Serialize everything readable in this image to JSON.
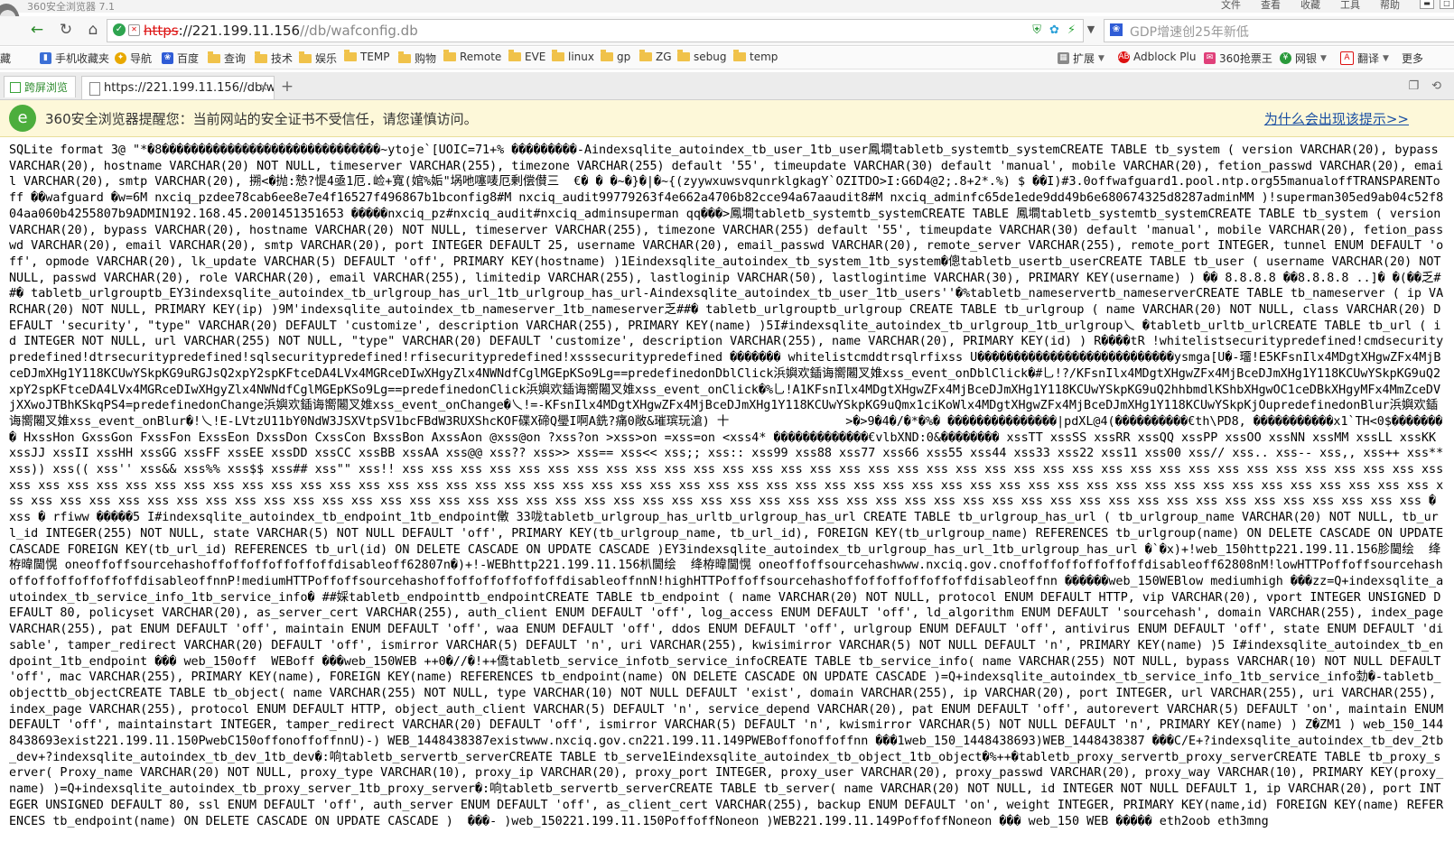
{
  "window": {
    "title": "360安全浏览器 7.1",
    "menus": [
      "文件",
      "查看",
      "收藏",
      "工具",
      "帮助"
    ]
  },
  "address": {
    "scheme": "https",
    "host": "://221.199.11.156",
    "path": "//db/wafconfig.db"
  },
  "search": {
    "placeholder": "GDP增速创25年新低"
  },
  "bookmarks": [
    {
      "label": "藏"
    },
    {
      "label": "手机收藏夹"
    },
    {
      "label": "导航"
    },
    {
      "label": "百度"
    },
    {
      "label": "查询"
    },
    {
      "label": "技术"
    },
    {
      "label": "娱乐"
    },
    {
      "label": "TEMP"
    },
    {
      "label": "购物"
    },
    {
      "label": "Remote"
    },
    {
      "label": "EVE"
    },
    {
      "label": "linux"
    },
    {
      "label": "gp"
    },
    {
      "label": "ZG"
    },
    {
      "label": "sebug"
    },
    {
      "label": "temp"
    },
    {
      "label": "扩展"
    },
    {
      "label": "Adblock Plu"
    },
    {
      "label": "360抢票王"
    },
    {
      "label": "网银"
    },
    {
      "label": "翻译"
    },
    {
      "label": "更多"
    }
  ],
  "tabs": {
    "split_label": "跨屏浏览",
    "active_label": "https://221.199.11.156//db/w"
  },
  "warning": {
    "text": "360安全浏览器提醒您：当前网站的安全证书不受信任，请您谨慎访问。",
    "link": "为什么会出现该提示>>"
  },
  "content": {
    "raw": "SQLite format 3@ \"*�8������������������������������~ytoje`[UOIC=71+% ���������-Aindexsqlite_autoindex_tb_user_1tb_user鳳墹tabletb_systemtb_systemCREATE TABLE tb_system ( version VARCHAR(20), bypass VARCHAR(20), hostname VARCHAR(20) NOT NULL, timeserver VARCHAR(255), timezone VARCHAR(255) default '55', timeupdate VARCHAR(30) default 'manual', mobile VARCHAR(20), fetion_passwd VARCHAR(20), email VARCHAR(20), smtp VARCHAR(20), 搠<�抛:慹?惿4亟1厄.崄+寬(婠%姤\"埚吔噻唛厄剰偿儧三  €� � �~�}�|�~{(zyywxuwsvqunrklgkagY`OZITDO>I:G6D4@2;.8+2*.%) $ ��I)#3.0offwafguard1.pool.ntp.org55manualoffTRANSPARENToff ��wafguard �w=6M nxciq_pzdee78cab6ee8e7e4f16527f496867b1bconfig8#M nxciq_audit99779263f4e662a4706b82cce94a67aaudit8#M nxciq_adminfc65de1ede9dd49b6e680674325d8287adminMM )!superman305ed9ab04c52f804aa060b4255807b9ADMIN192.168.45.2001451351653 �����nxciq_pz#nxciq_audit#nxciq_adminsuperman qq���>鳳墹tabletb_systemtb_systemCREATE TABLE 鳳墹tabletb_systemtb_systemCREATE TABLE tb_system ( version VARCHAR(20), bypass VARCHAR(20), hostname VARCHAR(20) NOT NULL, timeserver VARCHAR(255), timezone VARCHAR(255) default '55', timeupdate VARCHAR(30) default 'manual', mobile VARCHAR(20), fetion_passwd VARCHAR(20), email VARCHAR(20), smtp VARCHAR(20), port INTEGER DEFAULT 25, username VARCHAR(20), email_passwd VARCHAR(20), remote_server VARCHAR(255), remote_port INTEGER, tunnel ENUM DEFAULT 'off', opmode VARCHAR(20), lk_update VARCHAR(5) DEFAULT 'off', PRIMARY KEY(hostname) )1Eindexsqlite_autoindex_tb_system_1tb_system�傯tabletb_usertb_userCREATE TABLE tb_user ( username VARCHAR(20) NOT NULL, passwd VARCHAR(20), role VARCHAR(20), email VARCHAR(255), limitedip VARCHAR(255), lastloginip VARCHAR(50), lastlogintime VARCHAR(30), PRIMARY KEY(username) ) �� 8.8.8.8 ��8.8.8.8 ..]� �(��乏##� tabletb_urlgrouptb_EY3indexsqlite_autoindex_tb_urlgroup_has_url_1tb_urlgroup_has_url-Aindexsqlite_autoindex_tb_user_1tb_users''�%tabletb_nameservertb_nameserverCREATE TABLE tb_nameserver ( ip VARCHAR(20) NOT NULL, PRIMARY KEY(ip) )9M'indexsqlite_autoindex_tb_nameserver_1tb_nameserver乏##� tabletb_urlgrouptb_urlgroup CREATE TABLE tb_urlgroup ( name VARCHAR(20) NOT NULL, class VARCHAR(20) DEFAULT 'security', \"type\" VARCHAR(20) DEFAULT 'customize', description VARCHAR(255), PRIMARY KEY(name) )5I#indexsqlite_autoindex_tb_urlgroup_1tb_urlgroup乀 �tabletb_urltb_urlCREATE TABLE tb_url ( id INTEGER NOT NULL, url VARCHAR(255) NOT NULL, \"type\" VARCHAR(20) DEFAULT 'customize', description VARCHAR(255), name VARCHAR(20), PRIMARY KEY(id) ) R����tR !whitelistsecuritypredefined!cmdsecuritypredefined!dtrsecuritypredefined!sqlsecuritypredefined!rfisecuritypredefined!xsssecuritypredefined ������� whitelistcmddtrsqlrfixss U���������������������������ysmga[U�-璢!E5KFsnIlx4MDgtXHgwZFx4MjBceDJmXHg1Y118KCUwYSkpKG9uRGJsQ2xpY2spKFtceDA4LVx4MGRceDIwXHgyZlx4NWNdfCglMGEpKSo9Lg==predefinedonDblClick浜嬩欢鍤诲嚮闂叉婎xss_event_onDblClick�#乚!?/KFsnIlx4MDgtXHgwZFx4MjBceDJmXHg1Y118KCUwYSkpKG9uQ2xpY2spKFtceDA4LVx4MGRceDIwXHgyZlx4NWNdfCglMGEpKSo9Lg==predefinedonClick浜嬩欢鍤诲嚮闂叉婎xss_event_onClick�%乚!A1KFsnIlx4MDgtXHgwZFx4MjBceDJmXHg1Y118KCUwYSkpKG9uQ2hhbmdlKShbXHgwOC1ceDBkXHgyMFx4MmZceDVjXXwoJTBhKSkqPS4=predefinedonChange浜嬩欢鍤诲嚮闂叉婎xss_event_onChange�乀!=-KFsnIlx4MDgtXHgwZFx4MjBceDJmXHg1Y118KCUwYSkpKG9uQmx1ciKoWlx4MDgtXHgwZFx4MjBceDJmXHg1Y118KCUwYSkpKjOupredefinedonBlur浜嬩欢鍤诲嚮闂叉婎xss_event_onBlur�!乀!E-LVtzU11bY0NdW3JSXVtpSV1bcFBdW3RUXShcKOF碟X碲Q璺I啊A銑?痛0敞&璀瑸玩滄) 十                >�>9�4�/�*�%� ���������������|pdXL@4(����������€th\\PD8, �����������x1`TH<0$�������� HxssHon GxssGon FxssFon ExssEon DxssDon CxssCon BxssBon AxssAon @xss@on ?xss?on >xss>on =xss=on <xss4* �������������€vlbXND:0&�������� xssTT xssSS xssRR xssQQ xssPP xssOO xssNN xssMM xssLL xssKK xssJJ xssII xssHH xssGG xssFF xssEE xssDD xssCC xssBB xssAA xss@@ xss?? xss>> xss== xss<< xss;; xss:: xss99 xss88 xss77 xss66 xss55 xss44 xss33 xss22 xss11 xss00 xss// xss.. xss-- xss,, xss++ xss** xss)) xss(( xss'' xss&& xss%% xss$$ xss## xss\"\" xss!! xss xss xss xss xss xss xss xss xss xss xss xss xss xss xss xss xss xss xss xss xss xss xss xss xss xss xss xss xss xss xss xss xss xss xss xss xss xss xss xss xss xss xss xss xss xss xss xss xss xss xss xss xss xss xss xss xss xss xss xss xss xss xss xss xss xss xss xss xss xss xss xss xss xss xss xss xss xss xss xss xss xss xss xss xss xss xss xss xss xss xss xss xss xss xss xss xss xss xss xss xss xss xss xss xss xss xss xss xss xss xss xss xss xss xss xss xss xss xss xss xss xss xss xss xss xss xss xss xss xss xss xss xss xss � xss � rfiww �����5 I#indexsqlite_autoindex_tb_endpoint_1tb_endpoint僌 33咙tabletb_urlgroup_has_urltb_urlgroup_has_url CREATE TABLE tb_urlgroup_has_url ( tb_urlgroup_name VARCHAR(20) NOT NULL, tb_url_id INTEGER(255) NOT NULL, state VARCHAR(5) NOT NULL DEFAULT 'off', PRIMARY KEY(tb_urlgroup_name, tb_url_id), FOREIGN KEY(tb_urlgroup_name) REFERENCES tb_urlgroup(name) ON DELETE CASCADE ON UPDATE CASCADE FOREIGN KEY(tb_url_id) REFERENCES tb_url(id) ON DELETE CASCADE ON UPDATE CASCADE )EY3indexsqlite_autoindex_tb_urlgroup_has_url_1tb_urlgroup_has_url �`�x)+!web_150http221.199.11.156胗閫绘  绛栫暐閫愰 oneoffoffsourcehashoffoffoffoffoffoffdisableoff62807n�)+!-WEBhttp221.199.11.156朳閫绘  绛栫暐閫愰 oneoffoffsourcehashwww.nxciq.gov.cnoffoffoffoffoffoffdisableoff62808nM!lowHTTPoffoffsourcehashoffoffoffoffoffoffdisableoffnnP!mediumHTTPoffoffsourcehashoffoffoffoffoffoffdisableoffnnN!highHTTPoffoffsourcehashoffoffoffoffoffoffdisableoffnn ������web_150WEBlow mediumhigh ���zz=Q+indexsqlite_autoindex_tb_service_info_1tb_service_info� ##婇tabletb_endpointtb_endpointCREATE TABLE tb_endpoint ( name VARCHAR(20) NOT NULL, protocol ENUM DEFAULT HTTP, vip VARCHAR(20), vport INTEGER UNSIGNED DEFAULT 80, policyset VARCHAR(20), as_server_cert VARCHAR(255), auth_client ENUM DEFAULT 'off', log_access ENUM DEFAULT 'off', ld_algorithm ENUM DEFAULT 'sourcehash', domain VARCHAR(255), index_page VARCHAR(255), pat ENUM DEFAULT 'off', maintain ENUM DEFAULT 'off', waa ENUM DEFAULT 'off', ddos ENUM DEFAULT 'off', urlgroup ENUM DEFAULT 'off', antivirus ENUM DEFAULT 'off', state ENUM DEFAULT 'disable', tamper_redirect VARCHAR(20) DEFAULT 'off', ismirror VARCHAR(5) DEFAULT 'n', uri VARCHAR(255), kwisimirror VARCHAR(5) NOT NULL DEFAULT 'n', PRIMARY KEY(name) )5 I#indexsqlite_autoindex_tb_endpoint_1tb_endpoint ��� web_150off  WEBoff ���web_150WEB ++0�//�!++僑tabletb_service_infotb_service_infoCREATE TABLE tb_service_info( name VARCHAR(255) NOT NULL, bypass VARCHAR(10) NOT NULL DEFAULT 'off', mac VARCHAR(255), PRIMARY KEY(name), FOREIGN KEY(name) REFERENCES tb_endpoint(name) ON DELETE CASCADE ON UPDATE CASCADE )=Q+indexsqlite_autoindex_tb_service_info_1tb_service_info勎�-tabletb_objecttb_objectCREATE TABLE tb_object( name VARCHAR(255) NOT NULL, type VARCHAR(10) NOT NULL DEFAULT 'exist', domain VARCHAR(255), ip VARCHAR(20), port INTEGER, url VARCHAR(255), uri VARCHAR(255), index_page VARCHAR(255), protocol ENUM DEFAULT HTTP, object_auth_client VARCHAR(5) DEFAULT 'n', service_depend VARCHAR(20), pat ENUM DEFAULT 'off', autorevert VARCHAR(5) DEFAULT 'on', maintain ENUM DEFAULT 'off', maintainstart INTEGER, tamper_redirect VARCHAR(20) DEFAULT 'off', ismirror VARCHAR(5) DEFAULT 'n', kwismirror VARCHAR(5) NOT NULL DEFAULT 'n', PRIMARY KEY(name) ) Z�ZM1 ) web_150_1448438693exist221.199.11.150PwebC150offonoffoffnnU)-) WEB_1448438387existwww.nxciq.gov.cn221.199.11.149PWEBoffonoffoffnn ���1web_150_1448438693)WEB_1448438387 ���C/E+?indexsqlite_autoindex_tb_dev_2tb_dev+?indexsqlite_autoindex_tb_dev_1tb_dev�:响tabletb_servertb_serverCREATE TABLE tb_serve1Eindexsqlite_autoindex_tb_object_1tb_object�%++�tabletb_proxy_servertb_proxy_serverCREATE TABLE tb_proxy_server( Proxy_name VARCHAR(20) NOT NULL, proxy_type VARCHAR(10), proxy_ip VARCHAR(20), proxy_port INTEGER, proxy_user VARCHAR(20), proxy_passwd VARCHAR(20), proxy_way VARCHAR(10), PRIMARY KEY(proxy_name) )=Q+indexsqlite_autoindex_tb_proxy_server_1tb_proxy_server�:响tabletb_servertb_serverCREATE TABLE tb_server( name VARCHAR(20) NOT NULL, id INTEGER NOT NULL DEFAULT 1, ip VARCHAR(20), port INTEGER UNSIGNED DEFAULT 80, ssl ENUM DEFAULT 'off', auth_server ENUM DEFAULT 'off', as_client_cert VARCHAR(255), backup ENUM DEFAULT 'on', weight INTEGER, PRIMARY KEY(name,id) FOREIGN KEY(name) REFERENCES tb_endpoint(name) ON DELETE CASCADE ON UPDATE CASCADE )  ���- )web_150221.199.11.150PoffoffNoneon )WEB221.199.11.149PoffoffNoneon ��� web_150 WEB ����� eth2oob eth3mng"
  }
}
